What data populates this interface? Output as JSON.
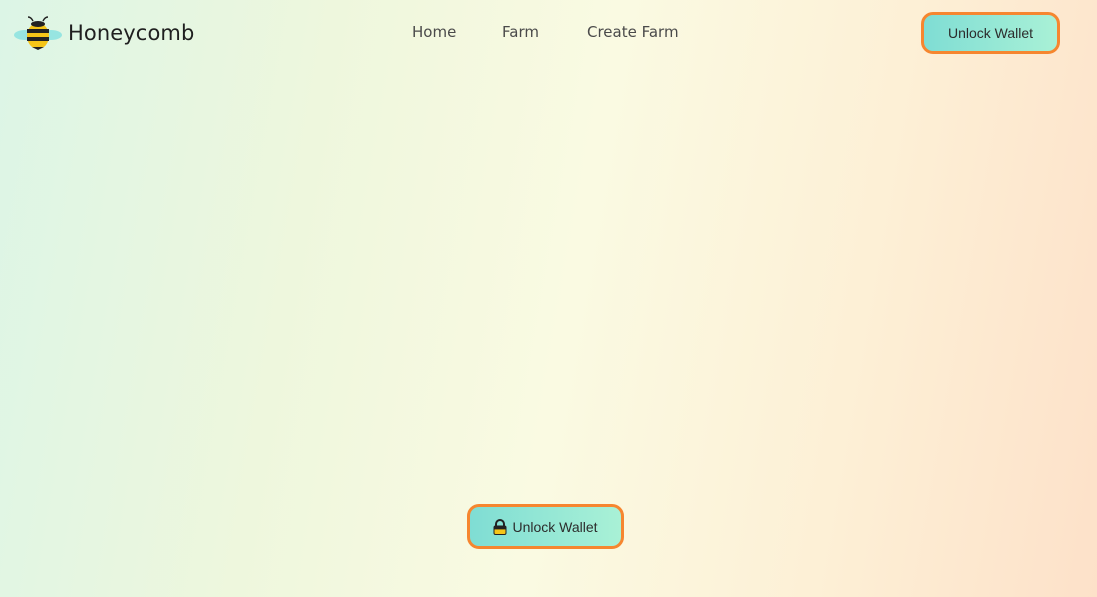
{
  "app": {
    "name": "Honeycomb",
    "logo_icon": "bee-icon"
  },
  "nav": {
    "items": [
      {
        "label": "Home"
      },
      {
        "label": "Farm"
      },
      {
        "label": "Create Farm"
      }
    ]
  },
  "header": {
    "unlock_wallet_label": "Unlock Wallet"
  },
  "main": {
    "unlock_wallet_label": "Unlock Wallet",
    "unlock_icon": "lock-icon"
  },
  "colors": {
    "button_gradient_start": "#7fddd4",
    "button_gradient_end": "#a9f1d6",
    "highlight_border": "#f6862f",
    "bee_yellow": "#f5c518",
    "bee_wing": "#8fe3e0"
  }
}
